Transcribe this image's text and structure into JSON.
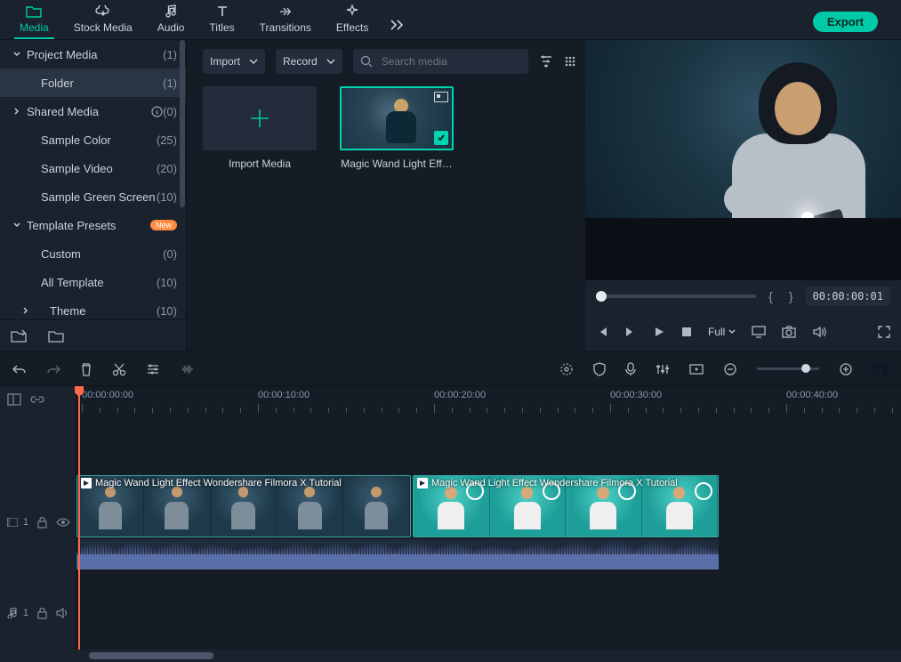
{
  "tabs": [
    {
      "id": "media",
      "label": "Media",
      "active": true
    },
    {
      "id": "stock",
      "label": "Stock Media"
    },
    {
      "id": "audio",
      "label": "Audio"
    },
    {
      "id": "titles",
      "label": "Titles"
    },
    {
      "id": "transitions",
      "label": "Transitions"
    },
    {
      "id": "effects",
      "label": "Effects"
    }
  ],
  "export_label": "Export",
  "tree": {
    "items": [
      {
        "name": "Project Media",
        "count": "(1)",
        "arrow": "down"
      },
      {
        "name": "Folder",
        "count": "(1)",
        "sub": true,
        "sel": true
      },
      {
        "name": "Shared Media",
        "count": "(0)",
        "arrow": "right",
        "info": true
      },
      {
        "name": "Sample Color",
        "count": "(25)",
        "sub": true
      },
      {
        "name": "Sample Video",
        "count": "(20)",
        "sub": true
      },
      {
        "name": "Sample Green Screen",
        "count": "(10)",
        "sub": true
      },
      {
        "name": "Template Presets",
        "count": "",
        "arrow": "down",
        "badge": "New"
      },
      {
        "name": "Custom",
        "count": "(0)",
        "sub": true
      },
      {
        "name": "All Template",
        "count": "(10)",
        "sub": true
      },
      {
        "name": "Theme",
        "count": "(10)",
        "arrow": "right",
        "sub2": true
      }
    ]
  },
  "browser": {
    "import_label": "Import",
    "record_label": "Record",
    "search_placeholder": "Search media",
    "import_media": "Import Media",
    "clip_name": "Magic Wand Light Eff…"
  },
  "preview": {
    "timecode": "00:00:00:01",
    "full_label": "Full"
  },
  "timeline": {
    "markers": [
      "00:00:00:00",
      "00:00:10:00",
      "00:00:20:00",
      "00:00:30:00",
      "00:00:40:00"
    ],
    "video_track_label": "1",
    "audio_track_label": "1",
    "clip1_title": "Magic Wand Light Effect  Wondershare Filmora X Tutorial",
    "clip2_title": "Magic Wand Light Effect  Wondershare Filmora X Tutorial"
  }
}
